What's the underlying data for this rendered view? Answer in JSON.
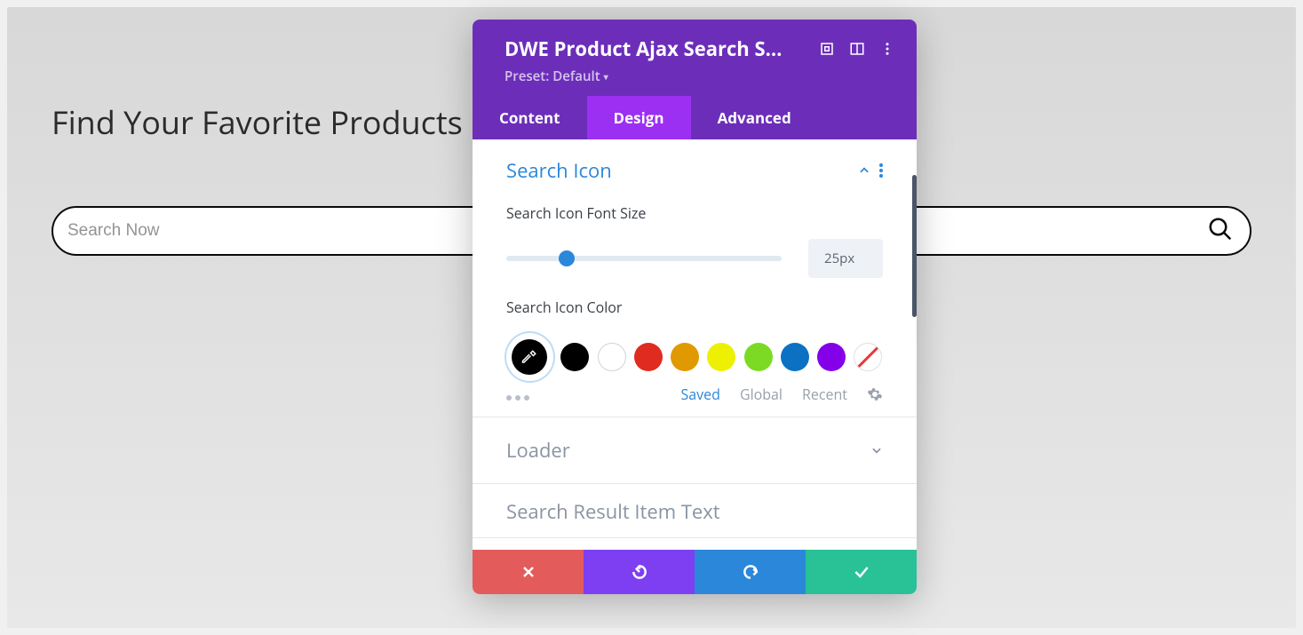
{
  "page": {
    "title": "Find Your Favorite Products",
    "search_placeholder": "Search Now"
  },
  "panel": {
    "title": "DWE Product Ajax Search S…",
    "preset_label": "Preset: Default",
    "tabs": {
      "content": "Content",
      "design": "Design",
      "advanced": "Advanced",
      "active": "design"
    },
    "section_search_icon": {
      "title": "Search Icon",
      "font_size_label": "Search Icon Font Size",
      "font_size_value": "25px",
      "color_label": "Search Icon Color",
      "swatches": [
        {
          "name": "picker-black",
          "hex": "#000000",
          "type": "picker",
          "selected": true
        },
        {
          "name": "black",
          "hex": "#000000"
        },
        {
          "name": "white",
          "hex": "#ffffff",
          "bordered": true
        },
        {
          "name": "red",
          "hex": "#e02b20"
        },
        {
          "name": "orange",
          "hex": "#e09900"
        },
        {
          "name": "yellow",
          "hex": "#edf000"
        },
        {
          "name": "green",
          "hex": "#7cda24"
        },
        {
          "name": "blue",
          "hex": "#0c71c3"
        },
        {
          "name": "purple",
          "hex": "#8300e9"
        },
        {
          "name": "none",
          "type": "none"
        }
      ],
      "color_tabs": {
        "saved": "Saved",
        "global": "Global",
        "recent": "Recent",
        "active": "saved"
      }
    },
    "section_loader": {
      "title": "Loader"
    },
    "section_next_partial": {
      "title": "Search Result Item Text"
    }
  }
}
